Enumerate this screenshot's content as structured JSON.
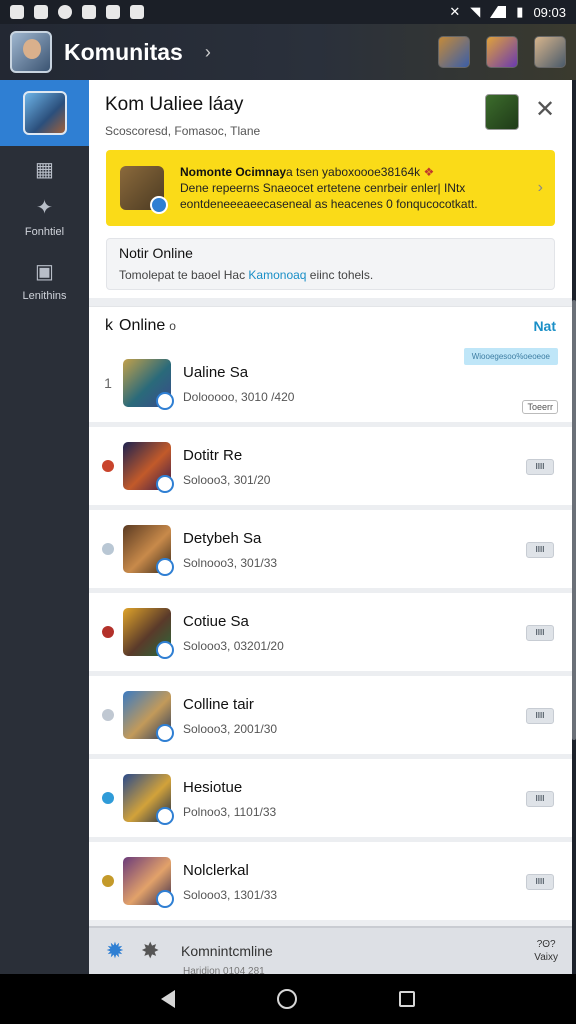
{
  "statusbar": {
    "time": "09:03"
  },
  "app": {
    "title": "Komunitas",
    "chevron": "›"
  },
  "sidebar": {
    "items": [
      {
        "label": "",
        "icon": "grid-icon",
        "glyph": "▦"
      },
      {
        "label": "Fonhtiel",
        "icon": "puzzle-icon",
        "glyph": "✦"
      },
      {
        "label": "Lenithins",
        "icon": "calendar-icon",
        "glyph": "▣"
      }
    ]
  },
  "header": {
    "title": "Kom  Ualiee  láay",
    "subtitle": "Scoscoresd, Fomasoc, Tlane",
    "close": "✕"
  },
  "banner": {
    "line1": "Nomonte Ocimnay",
    "line1_b": "a tsen yaboxoooe38164k",
    "line1_mark": "❖",
    "line2": "Dene repeerns Snaeocet ertetene cenrbeir enler| INtx",
    "line3": "eontdeneeeaeecaseneal as heacenes 0  fonqucocotkatt.",
    "chevron": "›"
  },
  "info": {
    "title": "Notir Online",
    "sub_pre": "Tomolepat te baoel Hac ",
    "sub_link": "Kamonoaq",
    "sub_post": " eiinc tohels."
  },
  "online": {
    "title": "Online",
    "prefix": "k",
    "dot": "o",
    "next": "Nat"
  },
  "rows": [
    {
      "index": "1",
      "name": "Ualine Sa",
      "meta": "Dolooooo, 3010 /420",
      "badge": "Wiooegesoo%oeoeoe",
      "tag": "Toeerr",
      "ball": "",
      "pill": ""
    },
    {
      "index": "",
      "name": "Dotitr Re",
      "meta": "Solooo3, 301/20",
      "badge": "",
      "tag": "",
      "ball": "#c9442c",
      "pill": "IIII"
    },
    {
      "index": "",
      "name": "Detybeh Sa",
      "meta": "Solnooo3, 301/33",
      "badge": "",
      "tag": "",
      "ball": "#b9c7d4",
      "pill": "IIII"
    },
    {
      "index": "",
      "name": "Cotiue Sa",
      "meta": "Solooo3, 03201/20",
      "badge": "",
      "tag": "",
      "ball": "#b3312a",
      "pill": "IIII"
    },
    {
      "index": "",
      "name": "Colline tair",
      "meta": "Solooo3, 2001/30",
      "badge": "",
      "tag": "",
      "ball": "#c0c8d2",
      "pill": "IIII"
    },
    {
      "index": "",
      "name": "Hesiotue",
      "meta": "Polnoo3, 1101/33",
      "badge": "",
      "tag": "",
      "ball": "#2f9bd8",
      "pill": "IIII"
    },
    {
      "index": "",
      "name": "Nolclerkal",
      "meta": "Solooo3, 1301/33",
      "badge": "",
      "tag": "",
      "ball": "#c49a2a",
      "pill": "IIII"
    }
  ],
  "bottom": {
    "text": "Komnintcmline",
    "sub": "Haridion 0104 281",
    "right1": "?ʘ?",
    "right2": "Vaixy"
  },
  "colors": {
    "accent": "#2f7fd3",
    "banner": "#fadb18",
    "link": "#1a8fc7"
  }
}
